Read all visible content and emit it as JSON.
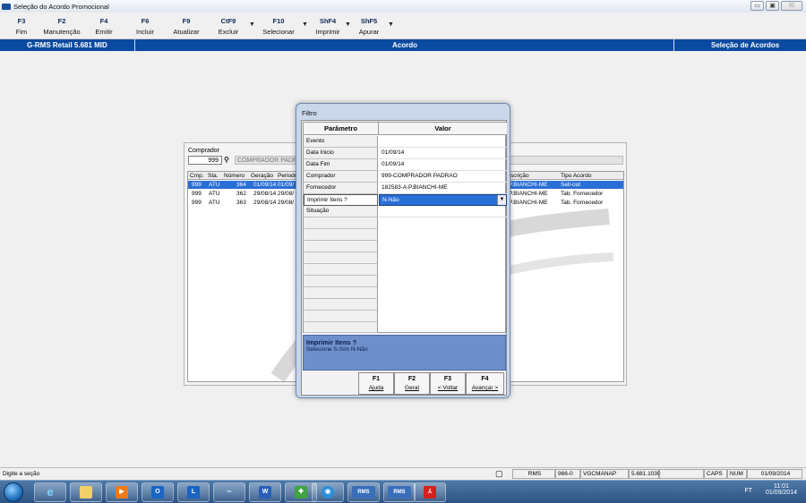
{
  "window": {
    "title": "Seleção do Acordo Promocional",
    "buttons": [
      "▭",
      "▣",
      "☒"
    ]
  },
  "toolbar": {
    "items": [
      {
        "key": "F3",
        "label": "Fim"
      },
      {
        "key": "F2",
        "label": "Manutenção"
      },
      {
        "key": "F4",
        "label": "Emitir"
      },
      {
        "key": "F6",
        "label": "Incluir"
      },
      {
        "key": "F9",
        "label": "Atualizar"
      },
      {
        "key": "CtF9",
        "label": "Excluir"
      },
      {
        "key": "F10",
        "label": "Selecionar"
      },
      {
        "key": "ShF4",
        "label": "Imprimir"
      },
      {
        "key": "ShF5",
        "label": "Apurar"
      }
    ]
  },
  "header": {
    "left": "G-RMS Retail 5.681 MID",
    "center": "Acordo",
    "right": "Seleção de Acordos"
  },
  "background_form": {
    "comprador_label": "Comprador",
    "comprador_code": "999",
    "comprador_name": "COMPRADOR PADRAO",
    "columns": [
      "Cmp.",
      "Sta.",
      "Número",
      "Geração",
      "Periodo",
      "scrição",
      "Tipo Acordo"
    ],
    "rows": [
      {
        "cmp": "999",
        "sta": "ATU",
        "num": "364",
        "ger": "01/09/14",
        "per": "01/09/",
        "desc": "P.BIANCHI-ME",
        "tipo": "Sell-out",
        "selected": true
      },
      {
        "cmp": "999",
        "sta": "ATU",
        "num": "362",
        "ger": "29/08/14",
        "per": "29/08/",
        "desc": "P.BIANCHI-ME",
        "tipo": "Tab. Fornecedor",
        "selected": false
      },
      {
        "cmp": "999",
        "sta": "ATU",
        "num": "363",
        "ger": "29/08/14",
        "per": "29/08/",
        "desc": "P.BIANCHI-ME",
        "tipo": "Tab. Fornecedor",
        "selected": false
      }
    ]
  },
  "dialog": {
    "title": "Filtro",
    "col_param": "Parâmetro",
    "col_value": "Valor",
    "params": [
      {
        "name": "Evento",
        "value": ""
      },
      {
        "name": "Data Inicio",
        "value": "01/09/14"
      },
      {
        "name": "Data Fim",
        "value": "01/09/14"
      },
      {
        "name": "Comprador",
        "value": "999-COMPRADOR PADRAO"
      },
      {
        "name": "Fornecedor",
        "value": "182583-A.P.BIANCHI-ME"
      },
      {
        "name": "Imprimir Itens ?",
        "value": "N-Não"
      },
      {
        "name": "Situação",
        "value": ""
      }
    ],
    "help_title": "Imprimir Itens ?",
    "help_text": "Selecione S-Sim N-Não",
    "buttons": [
      {
        "key": "F1",
        "label": "Ajuda"
      },
      {
        "key": "F2",
        "label": "Geral"
      },
      {
        "key": "F3",
        "label": "< Voltar"
      },
      {
        "key": "F4",
        "label": "Avançar >"
      }
    ]
  },
  "statusbar": {
    "message": "Digite a seção",
    "panes": [
      "RMS",
      "966-0",
      "VGCMANAP",
      "5.681.1030",
      "CAPS",
      "NUM",
      "01/09/2014"
    ]
  },
  "taskbar": {
    "tray_lang": "FT",
    "clock_time": "11:01",
    "clock_date": "01/09/2014",
    "apps": [
      "ie",
      "explorer",
      "media",
      "outlook",
      "lync",
      "app",
      "word",
      "setup",
      "remote",
      "rms1",
      "rms2",
      "pdf"
    ]
  },
  "colors": {
    "header_blue": "#0a4aa0",
    "selection_blue": "#2a6fd6",
    "help_blue": "#6e8fca"
  }
}
